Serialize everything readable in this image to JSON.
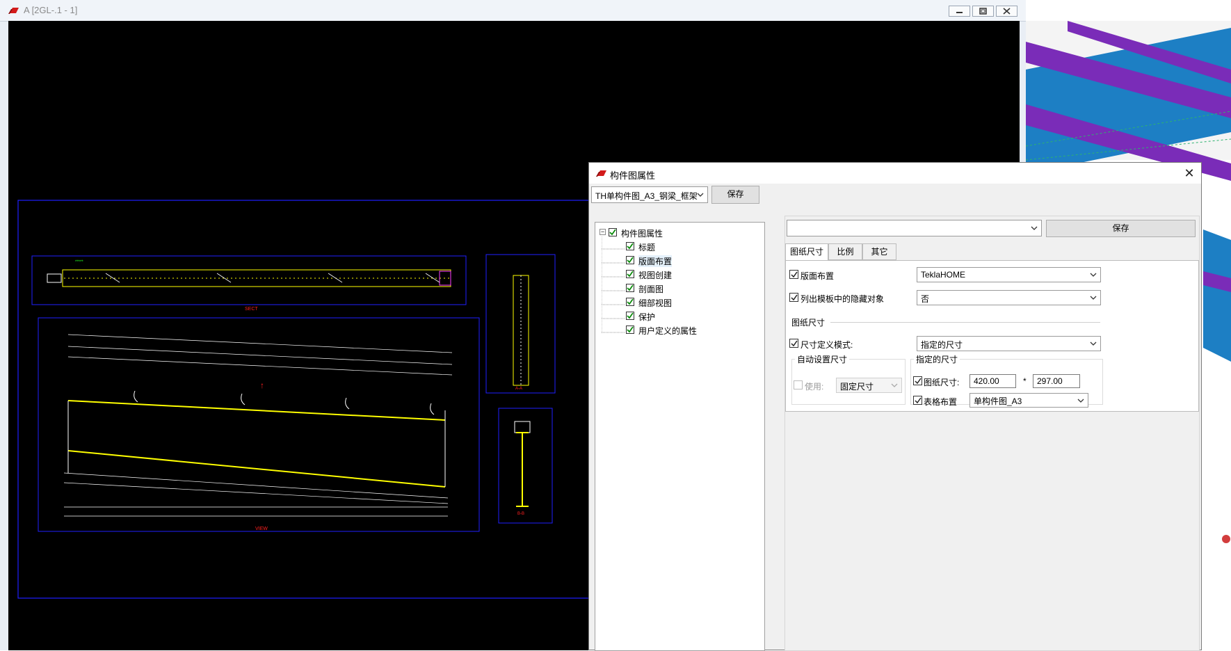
{
  "drawing_window": {
    "title": "A    [2GL-.1 - 1]"
  },
  "dialog": {
    "title": "构件图属性",
    "preset_select": "TH单构件图_A3_钢梁_框架",
    "save_label": "保存",
    "tree": {
      "root": "构件图属性",
      "items": [
        "标题",
        "版面布置",
        "视图创建",
        "剖面图",
        "细部视图",
        "保护",
        "用户定义的属性"
      ],
      "selected": "版面布置"
    },
    "right_select": "",
    "right_save_label": "保存",
    "tabs": [
      "图纸尺寸",
      "比例",
      "其它"
    ],
    "active_tab": "图纸尺寸",
    "form": {
      "layout_label": "版面布置",
      "layout_value": "TeklaHOME",
      "list_hidden_label": "列出模板中的隐藏对象",
      "list_hidden_value": "否",
      "section_title": "图纸尺寸",
      "size_mode_label": "尺寸定义模式:",
      "size_mode_value": "指定的尺寸",
      "auto_group": "自动设置尺寸",
      "use_label": "使用:",
      "use_value": "固定尺寸",
      "specified_group": "指定的尺寸",
      "paper_size_label": "图纸尺寸:",
      "width": "420.00",
      "times": "*",
      "height": "297.00",
      "table_layout_label": "表格布置",
      "table_layout_value": "单构件图_A3"
    }
  },
  "colors": {
    "canvas": "#000000",
    "frame": "#1f1fff",
    "steel": "#ffff00",
    "dim": "#ffffff",
    "mark": "#ff2020",
    "model_purple": "#7a2cb8",
    "model_blue": "#1d7fc4"
  }
}
